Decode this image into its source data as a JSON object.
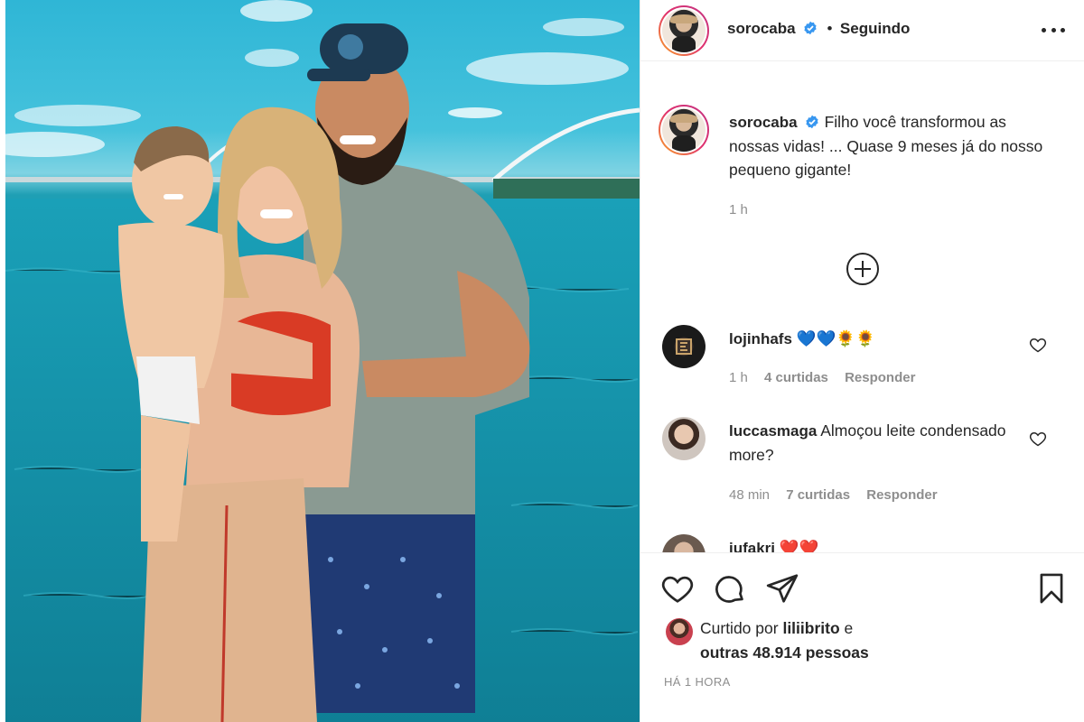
{
  "post": {
    "author": "sorocaba",
    "follow_status": "Seguindo",
    "separator": "•",
    "caption": "Filho você transformou as nossas vidas! ... Quase 9 meses já do nosso pequeno gigante!",
    "caption_time": "1 h",
    "posted_ago": "HÁ 1 HORA"
  },
  "comments": [
    {
      "username": "lojinhafs",
      "text": "💙💙🌻🌻",
      "time": "1 h",
      "likes": "4 curtidas",
      "reply": "Responder"
    },
    {
      "username": "luccasmaga",
      "text": "Almoçou leite condensado more?",
      "time": "48 min",
      "likes": "7 curtidas",
      "reply": "Responder"
    },
    {
      "username": "iufakri",
      "text": "❤️❤️"
    }
  ],
  "likes": {
    "prefix": "Curtido por",
    "user": "liliibrito",
    "connector": "e",
    "others": "outras 48.914 pessoas"
  },
  "icons": {
    "more": "more-options-icon",
    "verified": "verified-badge-icon",
    "load_more": "plus-circle-icon",
    "like": "heart-icon",
    "comment": "comment-bubble-icon",
    "share": "paper-plane-icon",
    "save": "bookmark-icon"
  },
  "colors": {
    "text": "#262626",
    "muted": "#8e8e8e",
    "verified": "#3897f0",
    "border": "#efefef"
  }
}
